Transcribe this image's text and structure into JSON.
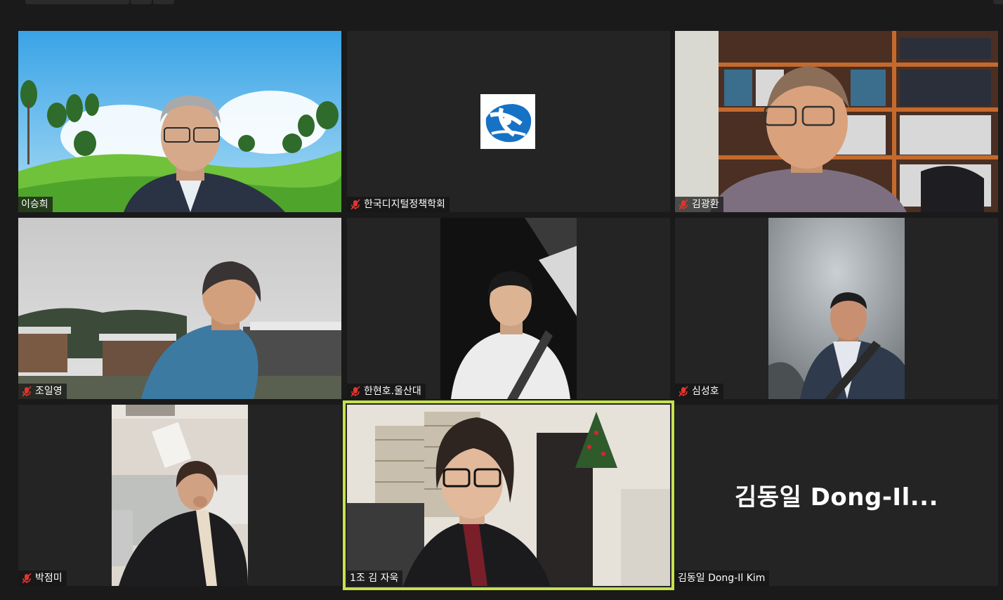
{
  "meeting": {
    "participants": [
      {
        "name": "이승희",
        "muted": false,
        "video": true
      },
      {
        "name": "한국디지털정책학회",
        "muted": true,
        "video": false,
        "logo": "blue-swirl-logo"
      },
      {
        "name": "김광환",
        "muted": true,
        "video": true
      },
      {
        "name": "조일영",
        "muted": true,
        "video": true
      },
      {
        "name": "한현호.울산대",
        "muted": true,
        "video": true
      },
      {
        "name": "심성호",
        "muted": true,
        "video": true
      },
      {
        "name": "박점미",
        "muted": true,
        "video": true
      },
      {
        "name": "1조 김 자욱",
        "muted": false,
        "video": true,
        "active_speaker": true
      },
      {
        "name": "김동일 Dong-Il Kim",
        "muted": false,
        "video": false,
        "display_name": "김동일 Dong-Il..."
      }
    ]
  },
  "colors": {
    "background": "#1a1a1a",
    "tile": "#242424",
    "active_speaker_border": "#c6e34c",
    "mute_icon": "#e0342f"
  },
  "icons": {
    "mute": "microphone-muted-icon"
  }
}
